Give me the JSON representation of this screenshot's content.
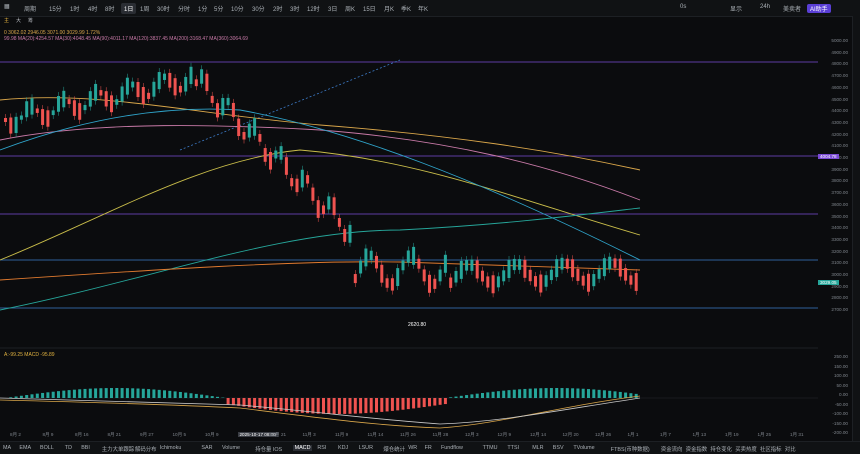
{
  "toolbar": {
    "items": [
      "",
      "周期",
      "15分",
      "1时",
      "4时",
      "8时",
      "1日",
      "1周",
      "30时",
      "分时",
      "1分",
      "5分",
      "10分",
      "30分",
      "2时",
      "3时",
      "12时",
      "3日",
      "周K",
      "15日",
      "月K",
      "季K",
      "年K"
    ],
    "active_index": 6,
    "right_items": [
      "0s",
      "显示",
      "24h",
      "美卖者",
      "AI助手"
    ]
  },
  "subbar": {
    "buttons": [
      "主",
      "大",
      "筹",
      "Z",
      "Y"
    ],
    "ohlc": "0  3062.02   2946.05   3071.00   3029.99   1.72%",
    "ma_line": "99.98   MA(20):4254.57   MA(30):4048.45   MA(90):4011.17   MA(120):3837.45   MA(200):3168.47   MA(360):3064.69"
  },
  "price_axis": {
    "ticks": [
      "5000.00",
      "4900.00",
      "4800.00",
      "4700.00",
      "4600.00",
      "4500.00",
      "4400.00",
      "4300.00",
      "4200.00",
      "4100.00",
      "4000.00",
      "3900.00",
      "3800.00",
      "3700.00",
      "3600.00",
      "3500.00",
      "3400.00",
      "3300.00",
      "3200.00",
      "3100.00",
      "3000.00",
      "2900.00",
      "2800.00",
      "2700.00"
    ],
    "badge_1": "4004.78",
    "badge_2": "3029.05",
    "low_marker": "2620.80"
  },
  "macd": {
    "label": "A:-99.25  MACD -95.89",
    "ticks": [
      "250.00",
      "150.00",
      "100.00",
      "50.00",
      "0.00",
      "-50.00",
      "-100.00",
      "-150.00",
      "-200.00"
    ]
  },
  "dates": [
    "8月 2",
    "8月 9",
    "8月 16",
    "8月 21",
    "9月 27",
    "10月 5",
    "10月 9",
    "2025-10-17 08:00",
    "10月 21",
    "11月 3",
    "11月 9",
    "11月 14",
    "11月 26",
    "11月 28",
    "12月 3",
    "12月 9",
    "12月 14",
    "12月 20",
    "12月 26",
    "1月 1",
    "1月 7",
    "1月 13",
    "1月 19",
    "1月 25",
    "1月 31"
  ],
  "highlight_date_index": 7,
  "bottom_bar": {
    "items": [
      "MA",
      "EMA",
      "BOLL",
      "TD",
      "BBI",
      "主力大单跟踪",
      "解码分布",
      "Ichimoku",
      "SAR",
      "Volume",
      "持仓量 IOS",
      "MACD",
      "RSI",
      "KDJ",
      "LSUR",
      "爆仓统计",
      "WR",
      "FR",
      "Fundflow",
      "TTMU",
      "TTSI",
      "MLR",
      "BSV",
      "TVolume",
      "FTBS(币种数据)",
      "资金流向",
      "资金指数",
      "持仓变化",
      "买卖热度",
      "社区指标",
      "对比"
    ],
    "active_index": 11
  },
  "colors": {
    "up": "#26a69a",
    "down": "#ef5350",
    "bg": "#0b0c0e",
    "purple_line": "#7b4bd6",
    "blue_line": "#3d7cc9"
  }
}
